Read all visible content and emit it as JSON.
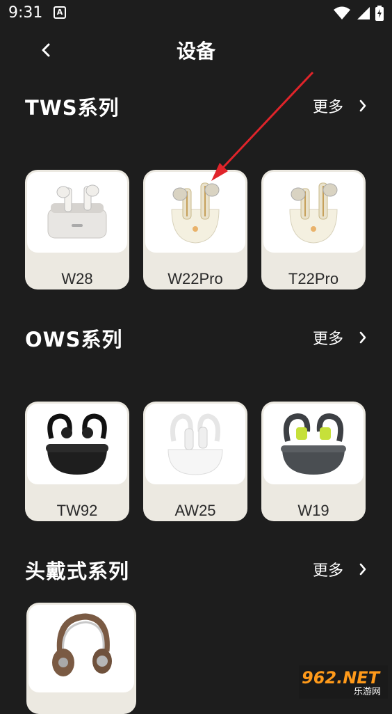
{
  "status": {
    "time": "9:31",
    "notif_badge": "A"
  },
  "header": {
    "title": "设备"
  },
  "sections": [
    {
      "title": "TWS系列",
      "more": "更多",
      "items": [
        {
          "name": "W28"
        },
        {
          "name": "W22Pro"
        },
        {
          "name": "T22Pro"
        }
      ]
    },
    {
      "title": "OWS系列",
      "more": "更多",
      "items": [
        {
          "name": "TW92"
        },
        {
          "name": "AW25"
        },
        {
          "name": "W19"
        }
      ]
    },
    {
      "title": "头戴式系列",
      "more": "更多",
      "items": [
        {
          "name": ""
        }
      ]
    }
  ],
  "watermark": {
    "logo": "962.NET",
    "sub": "乐游网"
  },
  "colors": {
    "background": "#1d1d1d",
    "card": "#ece9e1",
    "annotation": "#e0242a",
    "watermark": "#ff9a1a"
  }
}
